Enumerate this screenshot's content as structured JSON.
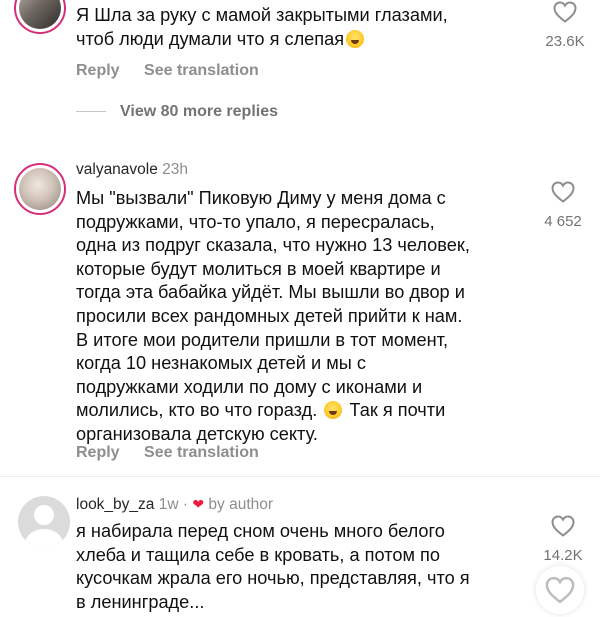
{
  "comments": [
    {
      "username": "",
      "time": "",
      "lines": [
        "Я Шла за руку с мамой закрытыми глазами,",
        "чтоб люди думали что я слепая"
      ],
      "emoji_after_last_line": "rofl",
      "likes": "23.6K",
      "reply_label": "Reply",
      "translate_label": "See translation"
    },
    {
      "username": "valyanavole",
      "time": "23h",
      "lines": [
        "Мы \"вызвали\" Пиковую Диму у меня дома с",
        "подружками, что-то упало, я пересралась,",
        "одна из подруг сказала, что нужно 13 человек,",
        "которые будут молиться в моей квартире и",
        "тогда эта бабайка уйдёт. Мы вышли во двор и",
        "просили всех рандомных детей прийти к нам.",
        "В итоге мои родители пришли в тот момент,",
        "когда 10 незнакомых детей и мы с",
        "подружками ходили по дому с иконами и",
        "молились, кто во что горазд.",
        "организовала детскую секту."
      ],
      "line10_tail": "Так я почти",
      "likes": "4 652",
      "reply_label": "Reply",
      "translate_label": "See translation"
    },
    {
      "username": "look_by_za",
      "time": "1w",
      "dot": "·",
      "author_label": "by author",
      "lines": [
        "я набирала перед сном очень много белого",
        "хлеба и тащила себе в кровать, а потом по",
        "кусочкам жрала его ночью, представляя, что я",
        "в ленинграде..."
      ],
      "likes": "14.2K"
    }
  ],
  "view_more": "View 80 more replies",
  "colors": {
    "story_ring": "#d62f7a",
    "author_heart": "#ed1c3c",
    "secondary_text": "#8e8e8e"
  },
  "icons": {
    "like": "heart-outline-icon",
    "author_like": "heart-filled-icon",
    "emoji": "rolling-on-floor-laughing-emoji"
  }
}
